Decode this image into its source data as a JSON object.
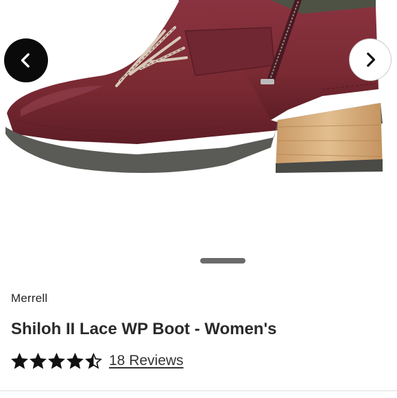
{
  "gallery": {
    "image_name": "boot-side-view",
    "prev_icon": "chevron-left-icon",
    "next_icon": "chevron-right-icon",
    "pager_icon": "pagination-bar"
  },
  "product": {
    "brand": "Merrell",
    "title": "Shiloh II Lace WP Boot - Women's",
    "rating": 4.5,
    "rating_max": 5,
    "reviews_label": "18 Reviews"
  },
  "colors": {
    "boot_leather": "#7a2a33",
    "boot_shadow": "#5e1d26",
    "sole": "#5a5a57",
    "heel_wood": "#d9b486",
    "collar_fabric": "#4e5245",
    "nav_prev_bg": "#0a0a0a",
    "nav_next_bg": "#ffffff",
    "pager": "#6b6b6b",
    "star": "#111111"
  }
}
